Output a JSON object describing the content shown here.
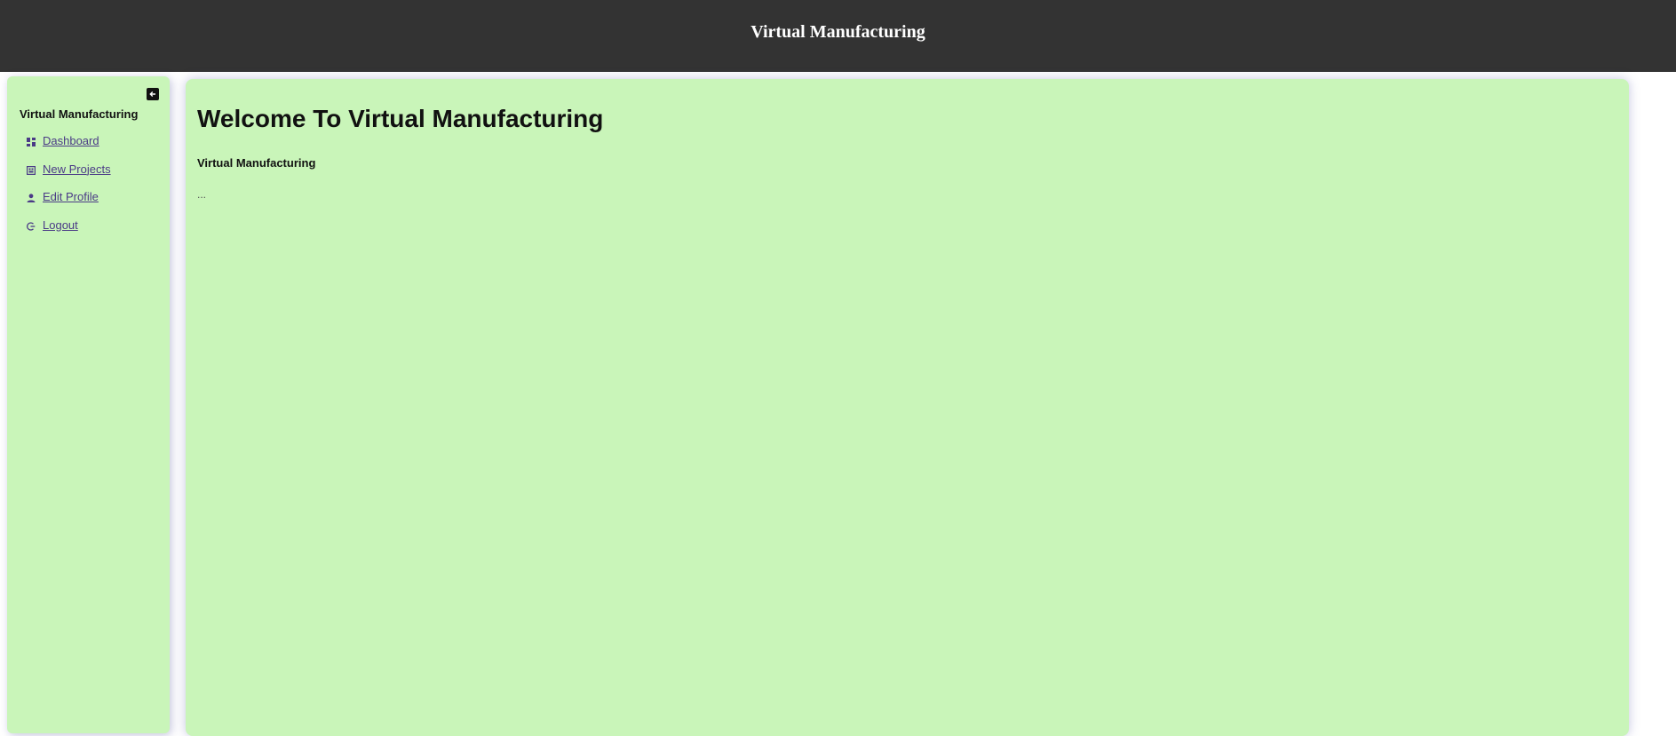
{
  "header": {
    "title": "Virtual Manufacturing"
  },
  "sidebar": {
    "title": "Virtual Manufacturing",
    "collapse_icon": "arrow-left-icon",
    "items": [
      {
        "label": "Dashboard",
        "icon": "dashboard-icon"
      },
      {
        "label": "New Projects",
        "icon": "projects-icon"
      },
      {
        "label": "Edit Profile",
        "icon": "person-icon"
      },
      {
        "label": "Logout",
        "icon": "logout-icon"
      }
    ]
  },
  "main": {
    "heading": "Welcome To Virtual Manufacturing",
    "subheading": "Virtual Manufacturing",
    "body": "..."
  },
  "colors": {
    "header_bg": "#333333",
    "panel_bg": "#c9f5b9",
    "link": "#4a3a86"
  }
}
